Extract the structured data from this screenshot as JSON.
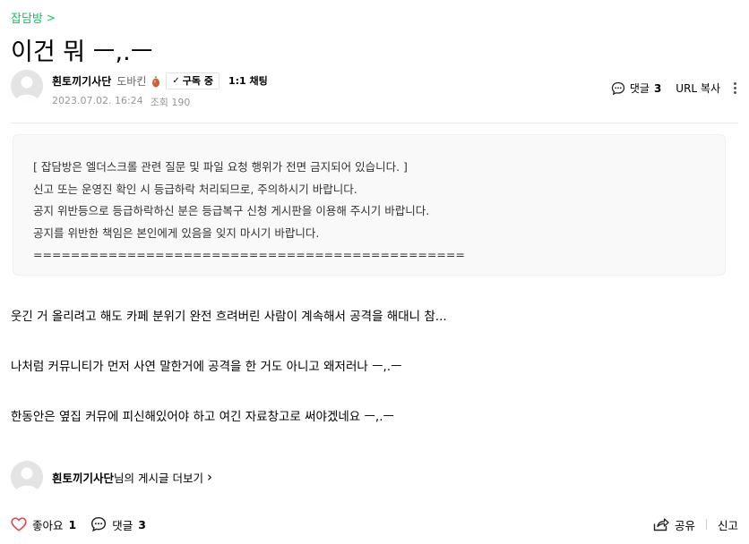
{
  "breadcrumb": {
    "label": "잡담방",
    "chevron": ">"
  },
  "post": {
    "title": "이건 뭐 ㅡ,.ㅡ",
    "author": {
      "name": "흰토끼기사단",
      "level": "도바킨",
      "subscribe_label": "구독 중",
      "subscribe_check": "✓",
      "chat_label": "1:1 채팅"
    },
    "date": "2023.07.02. 16:24",
    "views": "조회 190",
    "comment_label": "댓글",
    "comment_count": "3",
    "url_copy_label": "URL 복사"
  },
  "notice": {
    "lines": [
      "[ 잡담방은 엘더스크롤 관련 질문 및 파일 요청 행위가 전면 금지되어 있습니다. ]",
      "신고 또는 운영진 확인 시 등급하락 처리되므로, 주의하시기 바랍니다.",
      "공지 위반등으로 등급하락하신 분은 등급복구 신청 게시판을 이용해 주시기 바랍니다.",
      "공지를 위반한 책임은 본인에게 있음을 잊지 마시기 바랍니다.",
      "=============================================="
    ]
  },
  "body": {
    "paragraphs": [
      "웃긴 거 올리려고 해도 카페 분위기 완전 흐려버린 사람이 계속해서 공격을 해대니 참...",
      "나처럼 커뮤니티가 먼저 사연 말한거에 공격을 한 거도 아니고 왜저러나 ㅡ,.ㅡ",
      "한동안은 옆집 커뮤에 피신해있어야 하고 여긴 자료창고로 써야겠네요 ㅡ,.ㅡ"
    ]
  },
  "more_posts": {
    "author": "흰토끼기사단",
    "suffix": "님의 게시글 더보기",
    "chevron": "›"
  },
  "footer": {
    "like_label": "좋아요",
    "like_count": "1",
    "comment_label": "댓글",
    "comment_count": "3",
    "share_label": "공유",
    "report_label": "신고"
  },
  "icons": [
    "chevron-right-icon",
    "level-icon",
    "check-icon",
    "comment-icon",
    "more-icon",
    "heart-icon",
    "share-icon",
    "avatar-placeholder"
  ],
  "colors": {
    "accent": "#03c75a",
    "like": "#e5484d",
    "muted": "#979797"
  }
}
